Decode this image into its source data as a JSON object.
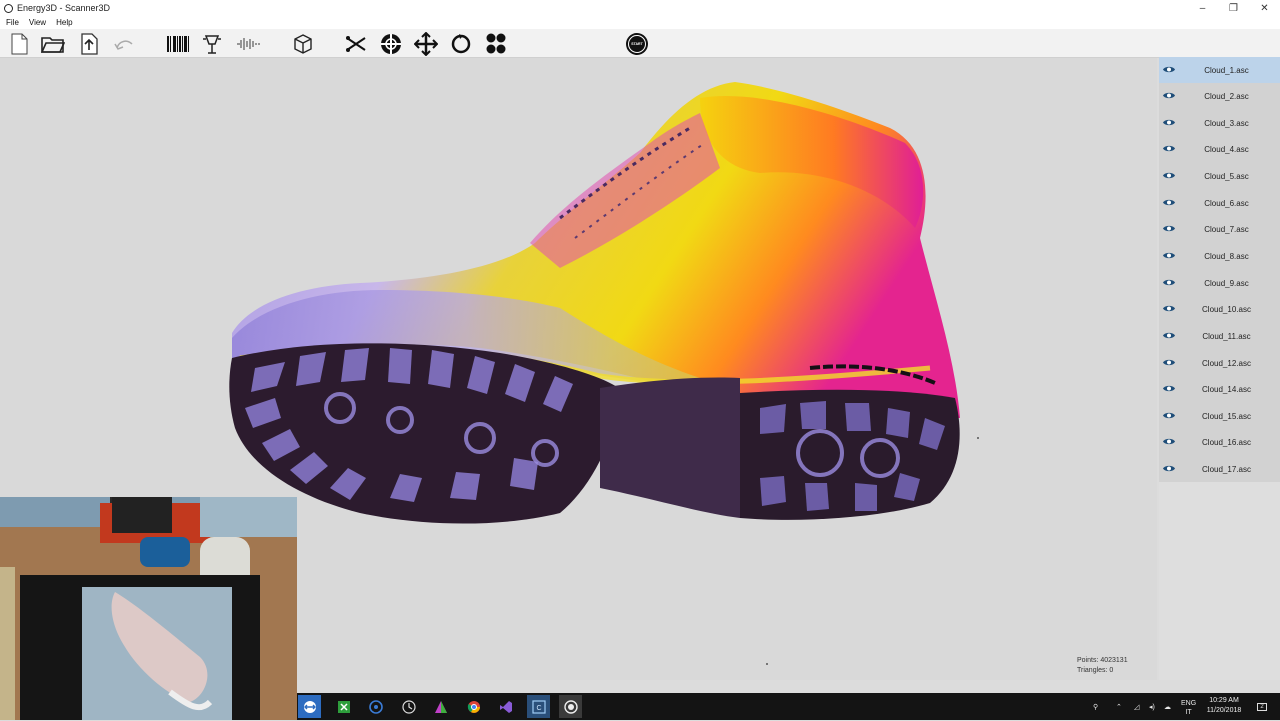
{
  "window": {
    "title": "Energy3D - Scanner3D",
    "controls": [
      "–",
      "❐",
      "✕"
    ]
  },
  "menu": [
    "File",
    "View",
    "Help"
  ],
  "toolbar": {
    "icons": [
      "new-document-icon",
      "open-folder-icon",
      "upload-icon",
      "undo-icon",
      "barcode-icon",
      "light-icon",
      "waveform-icon",
      "cube-icon",
      "scissors-icon",
      "target-icon",
      "move-icon",
      "rotate-icon",
      "cluster-icon",
      "start-icon"
    ],
    "start_label": "START"
  },
  "clouds": [
    {
      "name": "Cloud_1.asc",
      "selected": true
    },
    {
      "name": "Cloud_2.asc"
    },
    {
      "name": "Cloud_3.asc"
    },
    {
      "name": "Cloud_4.asc"
    },
    {
      "name": "Cloud_5.asc"
    },
    {
      "name": "Cloud_6.asc"
    },
    {
      "name": "Cloud_7.asc"
    },
    {
      "name": "Cloud_8.asc"
    },
    {
      "name": "Cloud_9.asc"
    },
    {
      "name": "Cloud_10.asc"
    },
    {
      "name": "Cloud_11.asc"
    },
    {
      "name": "Cloud_12.asc"
    },
    {
      "name": "Cloud_14.asc"
    },
    {
      "name": "Cloud_15.asc"
    },
    {
      "name": "Cloud_16.asc"
    },
    {
      "name": "Cloud_17.asc"
    }
  ],
  "stats": {
    "points": "Points: 4023131",
    "triangles": "Triangles: 0"
  },
  "taskbar": {
    "apps": [
      "teamviewer-icon",
      "spreadsheet-icon",
      "steam-icon",
      "clock-app-icon",
      "prism-icon",
      "chrome-icon",
      "visual-studio-icon",
      "cx-icon",
      "scanner-icon"
    ],
    "language": "ENG",
    "region": "IT",
    "time": "10:29 AM",
    "date": "11/20/2018",
    "notifications": "2"
  },
  "colors": {
    "selection": "#bcd3ea",
    "panel": "#d2d2d2",
    "viewport": "#d9d9d9",
    "taskbar": "#141414"
  }
}
